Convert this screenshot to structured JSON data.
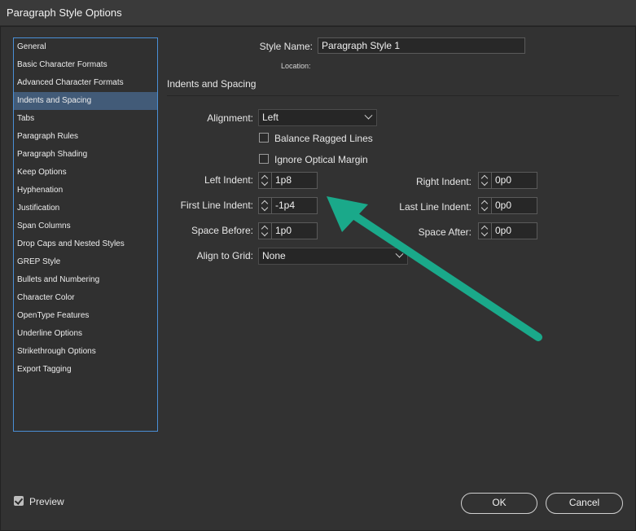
{
  "window": {
    "title": "Paragraph Style Options"
  },
  "sidebar": {
    "items": [
      {
        "label": "General"
      },
      {
        "label": "Basic Character Formats"
      },
      {
        "label": "Advanced Character Formats"
      },
      {
        "label": "Indents and Spacing",
        "selected": true
      },
      {
        "label": "Tabs"
      },
      {
        "label": "Paragraph Rules"
      },
      {
        "label": "Paragraph Shading"
      },
      {
        "label": "Keep Options"
      },
      {
        "label": "Hyphenation"
      },
      {
        "label": "Justification"
      },
      {
        "label": "Span Columns"
      },
      {
        "label": "Drop Caps and Nested Styles"
      },
      {
        "label": "GREP Style"
      },
      {
        "label": "Bullets and Numbering"
      },
      {
        "label": "Character Color"
      },
      {
        "label": "OpenType Features"
      },
      {
        "label": "Underline Options"
      },
      {
        "label": "Strikethrough Options"
      },
      {
        "label": "Export Tagging"
      }
    ]
  },
  "header": {
    "style_name_label": "Style Name:",
    "style_name_value": "Paragraph Style 1",
    "location_label": "Location:"
  },
  "section": {
    "title": "Indents and Spacing"
  },
  "form": {
    "alignment_label": "Alignment:",
    "alignment_value": "Left",
    "balance_ragged_label": "Balance Ragged Lines",
    "balance_ragged_checked": false,
    "ignore_optical_label": "Ignore Optical Margin",
    "ignore_optical_checked": false,
    "left_indent_label": "Left Indent:",
    "left_indent_value": "1p8",
    "right_indent_label": "Right Indent:",
    "right_indent_value": "0p0",
    "first_line_indent_label": "First Line Indent:",
    "first_line_indent_value": "-1p4",
    "last_line_indent_label": "Last Line Indent:",
    "last_line_indent_value": "0p0",
    "space_before_label": "Space Before:",
    "space_before_value": "1p0",
    "space_after_label": "Space After:",
    "space_after_value": "0p0",
    "align_to_grid_label": "Align to Grid:",
    "align_to_grid_value": "None"
  },
  "footer": {
    "preview_label": "Preview",
    "preview_checked": true,
    "ok_label": "OK",
    "cancel_label": "Cancel"
  },
  "annotation": {
    "arrow_color": "#1aa98a"
  },
  "colors": {
    "accent": "#4a8fd6",
    "selected_bg": "#425b78"
  }
}
